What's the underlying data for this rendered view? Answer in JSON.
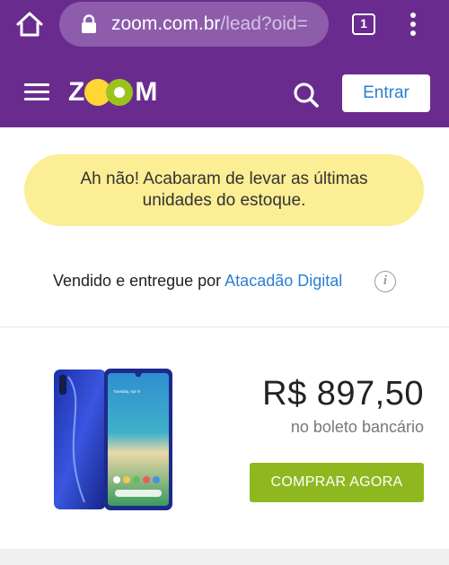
{
  "browser": {
    "url_host": "zoom.com.br",
    "url_path": "/lead?oid=",
    "tab_count": "1"
  },
  "header": {
    "logo_text_start": "Z",
    "logo_text_end": "M",
    "login_label": "Entrar"
  },
  "alert": {
    "line1": "Ah não! Acabaram de levar as últimas",
    "line2": "unidades do estoque."
  },
  "seller": {
    "prefix": "Vendido e entregue por ",
    "name": "Atacadão Digital",
    "info_symbol": "i"
  },
  "product": {
    "price": "R$ 897,50",
    "price_note": "no boleto bancário",
    "buy_label": "COMPRAR AGORA",
    "phone_lockscreen_time": "Tuesday, Apr 9"
  },
  "colors": {
    "brand_purple": "#6a2b8e",
    "alert_yellow": "#fbee94",
    "buy_green": "#8fb820",
    "link_blue": "#2a7fd4"
  }
}
